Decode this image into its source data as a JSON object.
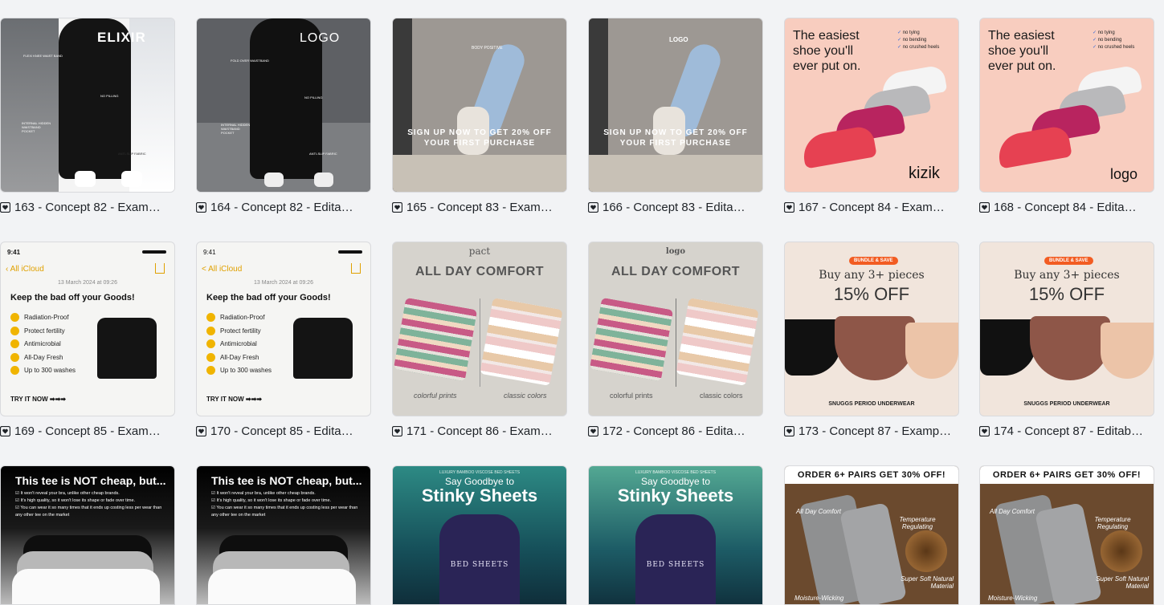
{
  "cards": [
    {
      "label": "163 - Concept 82 - Exam…",
      "brand": "ELIXIR",
      "lines": [
        "FLEX/ KNEE WAIST BAND",
        "NO PILLING",
        "INTERNAL HIDDEN WAISTBAND POCKET",
        "ANTI-SLIP FABRIC"
      ]
    },
    {
      "label": "164 - Concept 82 - Edita…",
      "brand": "LOGO",
      "lines": [
        "FOLD OVER WAISTBAND",
        "NO PILLING",
        "INTERNAL HIDDEN WAISTBAND POCKET",
        "ANTI-SLIP FABRIC"
      ]
    },
    {
      "label": "165 - Concept 83 - Exam…",
      "brand": "BODY POSITIVE",
      "offer": "SIGN UP NOW TO GET 20% OFF YOUR FIRST PURCHASE"
    },
    {
      "label": "166 - Concept 83 - Edita…",
      "brand": "LOGO",
      "offer": "SIGN UP NOW TO GET 20% OFF YOUR FIRST PURCHASE"
    },
    {
      "label": "167 - Concept 84 - Exam…",
      "headline": "The easiest shoe you'll ever put on.",
      "checks": [
        "no tying",
        "no bending",
        "no crushed heels"
      ],
      "brand": "kizik"
    },
    {
      "label": "168 - Concept 84 - Edita…",
      "headline": "The easiest shoe you'll ever put on.",
      "checks": [
        "no tying",
        "no bending",
        "no crushed heels"
      ],
      "brand": "logo"
    },
    {
      "label": "169 - Concept 85 - Exam…",
      "time": "9:41",
      "back": "All iCloud",
      "date": "13 March 2024 at 09:26",
      "title": "Keep the bad off your Goods!",
      "items": [
        "Radiation-Proof",
        "Protect fertility",
        "Antimicrobial",
        "All-Day Fresh",
        "Up to 300 washes"
      ],
      "cta": "TRY IT NOW ➡➡➡"
    },
    {
      "label": "170 - Concept 85 - Edita…",
      "time": "9:41",
      "back": "< All iCloud",
      "date": "13 March 2024 at 09:26",
      "title": "Keep the bad off your Goods!",
      "items": [
        "Radiation-Proof",
        "Protect fertility",
        "Antimicrobial",
        "All-Day Fresh",
        "Up to 300 washes"
      ],
      "cta": "TRY IT NOW ➡➡➡"
    },
    {
      "label": "171 - Concept 86 - Exam…",
      "brand": "pact",
      "title": "ALL DAY COMFORT",
      "left": "colorful prints",
      "right": "classic colors"
    },
    {
      "label": "172 - Concept 86 - Edita…",
      "brand": "logo",
      "title": "ALL DAY COMFORT",
      "left": "colorful prints",
      "right": "classic colors"
    },
    {
      "label": "173 - Concept 87 - Examp…",
      "badge": "BUNDLE & SAVE",
      "line1": "Buy any 3+ pieces",
      "line2": "15% OFF",
      "footer": "SNUGGS PERIOD UNDERWEAR"
    },
    {
      "label": "174 - Concept 87 - Editab…",
      "badge": "BUNDLE & SAVE",
      "line1": "Buy any 3+ pieces",
      "line2": "15% OFF",
      "footer": "SNUGGS PERIOD UNDERWEAR"
    },
    {
      "label": "",
      "title": "This tee is NOT cheap, but...",
      "items": [
        "It won't reveal your bra, unlike other cheap brands.",
        "It's high quality, so it won't lose its shape or fade over time.",
        "You can wear it so many times that it ends up costing less per wear than any other tee on the market"
      ]
    },
    {
      "label": "",
      "title": "This tee is NOT cheap, but...",
      "items": [
        "It won't reveal your bra, unlike other cheap brands.",
        "It's high quality, so it won't lose its shape or fade over time.",
        "You can wear it so many times that it ends up costing less per wear than any other tee on the market"
      ]
    },
    {
      "label": "",
      "kicker": "LUXURY BAMBOO VISCOSE BED SHEETS",
      "line1": "Say Goodbye to",
      "line2": "Stinky Sheets",
      "pack": "BED SHEETS"
    },
    {
      "label": "",
      "kicker": "LUXURY BAMBOO VISCOSE BED SHEETS",
      "line1": "Say Goodbye to",
      "line2": "Stinky Sheets",
      "pack": "BED SHEETS"
    },
    {
      "label": "",
      "title": "ORDER 6+ PAIRS GET 30% OFF!",
      "callouts": [
        "All Day Comfort",
        "Temperature Regulating",
        "Super Soft Natural Material",
        "Moisture-Wicking"
      ]
    },
    {
      "label": "",
      "title": "ORDER 6+ PAIRS GET 30% OFF!",
      "callouts": [
        "All Day Comfort",
        "Temperature Regulating",
        "Super Soft Natural Material",
        "Moisture-Wicking"
      ]
    }
  ],
  "colors": {
    "page_bg": "#f2f3f5",
    "accent_orange": "#f25c22",
    "check_yellow": "#f0b400"
  }
}
